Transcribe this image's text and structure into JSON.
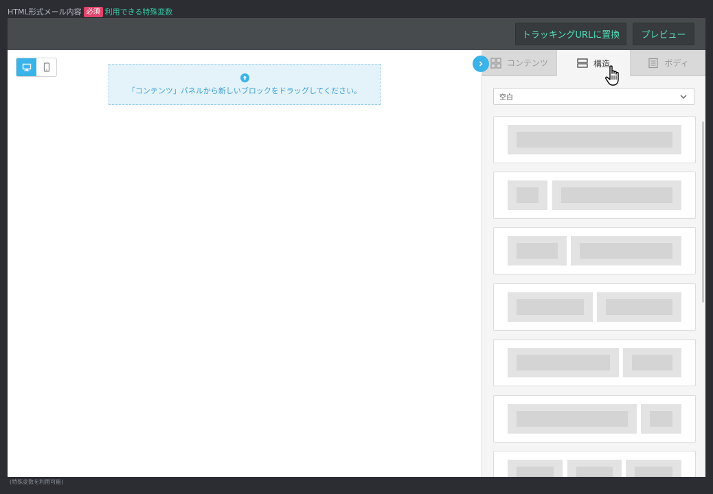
{
  "header": {
    "label": "HTML形式メール内容",
    "required_badge": "必須",
    "vars_link": "利用できる特殊変数"
  },
  "toolbar": {
    "tracking_label": "トラッキングURLに置換",
    "preview_label": "プレビュー"
  },
  "canvas": {
    "dropzone_text": "「コンテンツ」パネルから新しいブロックをドラッグしてください。",
    "device_active": "desktop"
  },
  "panel": {
    "tabs": [
      {
        "label": "コンテンツ",
        "icon": "grid-icon",
        "active": false
      },
      {
        "label": "構造",
        "icon": "rows-icon",
        "active": true
      },
      {
        "label": "ボディ",
        "icon": "document-icon",
        "active": false
      }
    ],
    "select_value": "空白"
  },
  "footer": {
    "note": "(特殊変数を利用可能)"
  },
  "colors": {
    "accent": "#3ab3e8",
    "button_text": "#4fe0bb",
    "required": "#e0446a",
    "link": "#35c7a4",
    "toolbar": "#474b4d"
  }
}
